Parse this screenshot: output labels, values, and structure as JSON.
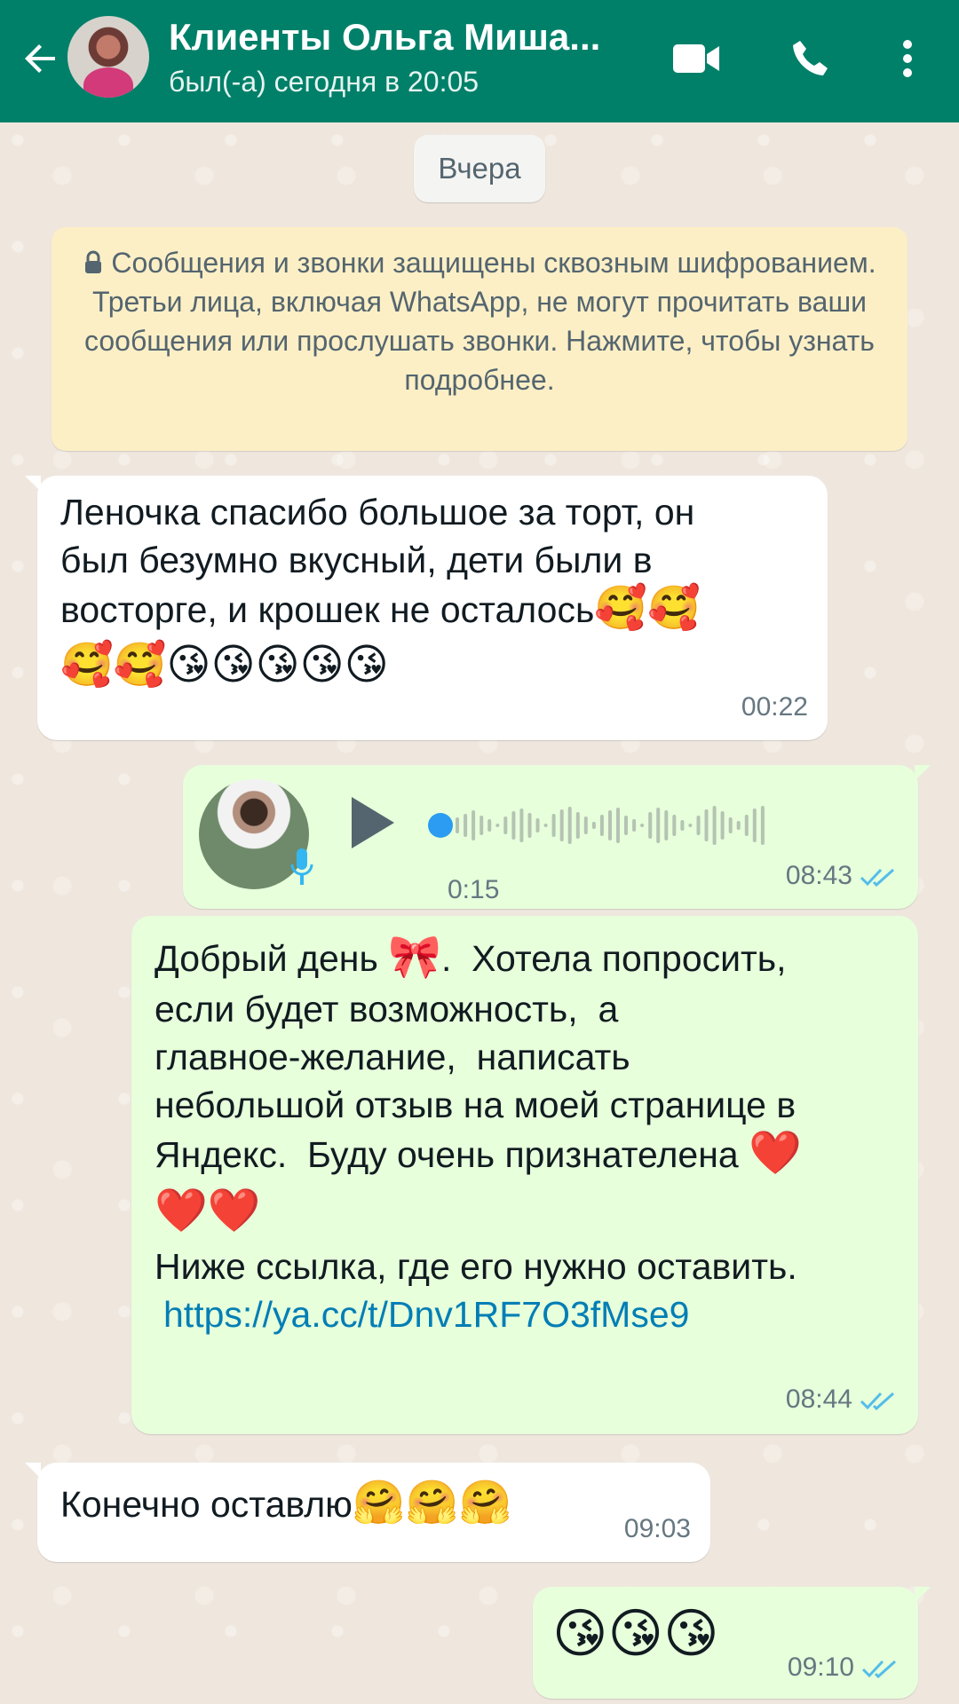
{
  "header": {
    "title": "Клиенты Ольга Миша...",
    "status": "был(-а) сегодня в 20:05"
  },
  "chat": {
    "date_chip": "Вчера",
    "e2e_notice": "Сообщения и звонки защищены сквозным шифрованием. Третьи лица, включая WhatsApp, не могут прочитать ваши сообщения или прослушать звонки. Нажмите, чтобы узнать подробнее.",
    "messages": [
      {
        "direction": "in",
        "text": "Леночка спасибо большое за торт, он\nбыл безумно вкусный, дети были в\nвосторге, и крошек не осталось",
        "emoji_inline": "🥰🥰",
        "emoji_line": "🥰🥰😘😘😘😘😘",
        "time": "00:22"
      },
      {
        "direction": "out",
        "type": "voice",
        "duration": "0:15",
        "time": "08:43",
        "progress": 0
      },
      {
        "direction": "out",
        "line1_a": "Добрый день ",
        "line1_emoji": "🎀",
        "line1_b": ".  Хотела попросить,",
        "body": "если будет возможность,  а\nглавное-желание,  написать\nнебольшой отзыв на моей странице в\nЯндекс.  Буду очень признателена ",
        "hearts_inline": "❤️",
        "hearts_line": "❤️❤️",
        "link_intro": "Ниже ссылка, где его нужно оставить.",
        "link": "https://ya.cc/t/Dnv1RF7O3fMse9",
        "time": "08:44"
      },
      {
        "direction": "in",
        "text": "Конечно оставлю",
        "emoji": "🤗🤗🤗",
        "time": "09:03"
      },
      {
        "direction": "out",
        "emoji": "😘😘😘",
        "time": "09:10"
      }
    ]
  },
  "colors": {
    "header": "#008069",
    "incoming_bubble": "#ffffff",
    "outgoing_bubble": "#e7ffdb",
    "notice": "#fcefc6",
    "read_ticks": "#53bdeb",
    "link": "#027eb5"
  },
  "icons": [
    "back-arrow-icon",
    "video-call-icon",
    "phone-icon",
    "more-vert-icon",
    "lock-icon",
    "play-icon",
    "mic-icon",
    "double-check-icon"
  ]
}
